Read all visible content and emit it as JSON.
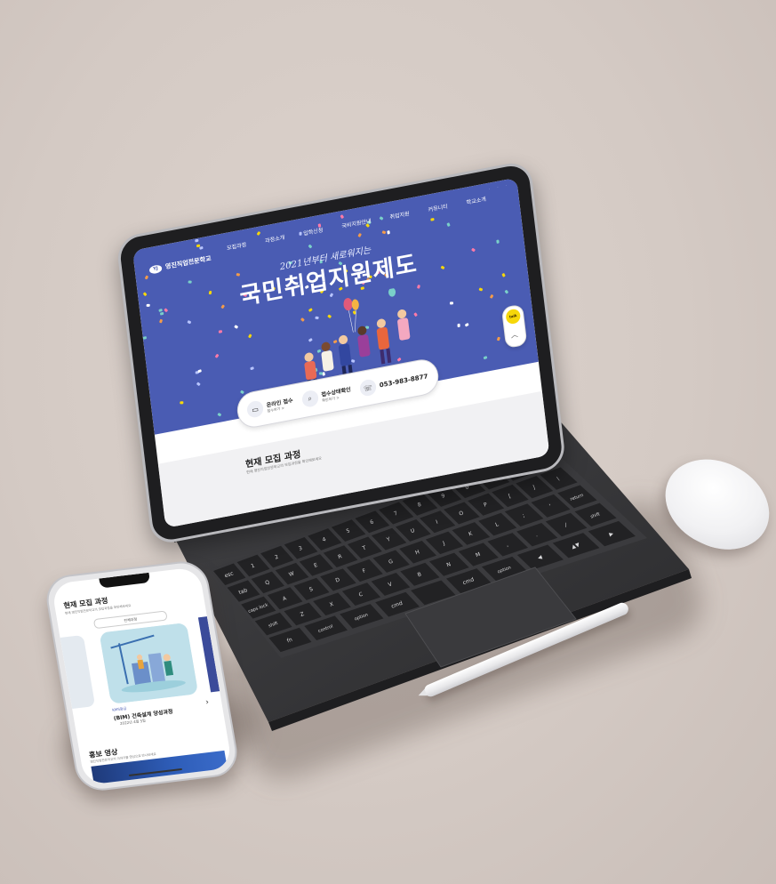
{
  "tablet_site": {
    "logo_text": "영진직업전문학교",
    "logo_mark": "YJ",
    "nav_items": [
      "모집과정",
      "과정소개",
      "입학신청",
      "국비지원안내",
      "취업지원",
      "커뮤니티",
      "학교소개"
    ],
    "util_links": [
      "·",
      "·",
      "·"
    ],
    "hero_script": "2021년부터 새로워지는",
    "hero_title": "국민취업지원제도",
    "info_bar": {
      "online_apply_title": "온라인 접수",
      "online_apply_sub": "접수하기 >",
      "status_title": "접수상태확인",
      "status_sub": "확인하기 >",
      "phone_number": "053-983-8877"
    },
    "kakao_label": "talk",
    "scroll_top_label": "︿",
    "section_title": "현재 모집 과정",
    "section_sub": "현재 영진직업전문학교의 모집과정을 확인해보세요"
  },
  "phone_site": {
    "section_title": "현재 모집 과정",
    "section_sub": "현재 영진직업전문학교의 모집과정을 확인해보세요",
    "select_value": "전체과정",
    "course_tag": "KMS등급",
    "course_name": "(BIM) 건축설계 양성과정",
    "course_date": "2022년 4월 5일",
    "next_icon": "›",
    "promo_title": "홍보 영상",
    "promo_sub": "영진직업전문학교의 이야기를 영상으로 만나보세요"
  },
  "colors": {
    "background": "#d4cac4",
    "hero_blue": "#4a5cb3",
    "keyboard": "#2d2d2f",
    "kakao_yellow": "#f6d70a"
  },
  "keyboard_keys": {
    "row1": [
      "esc",
      "1",
      "2",
      "3",
      "4",
      "5",
      "6",
      "7",
      "8",
      "9",
      "0",
      "-",
      "=",
      "delete"
    ],
    "row2": [
      "tab",
      "Q",
      "W",
      "E",
      "R",
      "T",
      "Y",
      "U",
      "I",
      "O",
      "P",
      "[",
      "]",
      "\\"
    ],
    "row3": [
      "caps lock",
      "A",
      "S",
      "D",
      "F",
      "G",
      "H",
      "J",
      "K",
      "L",
      ";",
      "'",
      "return"
    ],
    "row4": [
      "shift",
      "Z",
      "X",
      "C",
      "V",
      "B",
      "N",
      "M",
      ",",
      ".",
      "/",
      "shift"
    ],
    "row5": [
      "fn",
      "control",
      "option",
      "cmd",
      "",
      "cmd",
      "option",
      "◀",
      "▲▼",
      "▶"
    ]
  }
}
